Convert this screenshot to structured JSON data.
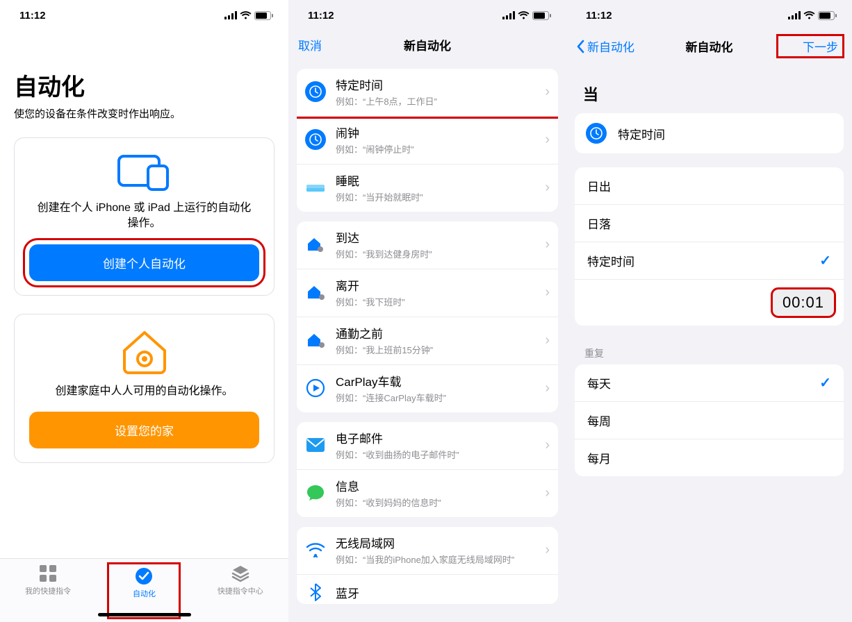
{
  "status": {
    "time": "11:12"
  },
  "screen1": {
    "title": "自动化",
    "subtitle": "使您的设备在条件改变时作出响应。",
    "card_personal": {
      "desc": "创建在个人 iPhone 或 iPad 上运行的自动化操作。",
      "button": "创建个人自动化"
    },
    "card_home": {
      "desc": "创建家庭中人人可用的自动化操作。",
      "button": "设置您的家"
    },
    "tabs": {
      "shortcuts": "我的快捷指令",
      "automation": "自动化",
      "gallery": "快捷指令中心"
    }
  },
  "screen2": {
    "nav_cancel": "取消",
    "nav_title": "新自动化",
    "groups": [
      [
        {
          "title": "特定时间",
          "sub": "例如：“上午8点，工作日”",
          "icon": "clock"
        },
        {
          "title": "闹钟",
          "sub": "例如：“闹钟停止时”",
          "icon": "clock"
        },
        {
          "title": "睡眠",
          "sub": "例如：“当开始就眠时”",
          "icon": "bed"
        }
      ],
      [
        {
          "title": "到达",
          "sub": "例如：“我到达健身房时”",
          "icon": "arrive"
        },
        {
          "title": "离开",
          "sub": "例如：“我下班时”",
          "icon": "leave"
        },
        {
          "title": "通勤之前",
          "sub": "例如：“我上班前15分钟”",
          "icon": "commute"
        },
        {
          "title": "CarPlay车载",
          "sub": "例如：“连接CarPlay车载时”",
          "icon": "carplay"
        }
      ],
      [
        {
          "title": "电子邮件",
          "sub": "例如：“收到曲扬的电子邮件时”",
          "icon": "mail"
        },
        {
          "title": "信息",
          "sub": "例如：“收到妈妈的信息时”",
          "icon": "message"
        }
      ],
      [
        {
          "title": "无线局域网",
          "sub": "例如：“当我的iPhone加入家庭无线局域网时”",
          "icon": "wifi"
        },
        {
          "title": "蓝牙",
          "sub": "",
          "icon": "bluetooth"
        }
      ]
    ]
  },
  "screen3": {
    "nav_back": "新自动化",
    "nav_title": "新自动化",
    "nav_next": "下一步",
    "when_label": "当",
    "trigger_name": "特定时间",
    "time_options": {
      "sunrise": "日出",
      "sunset": "日落",
      "specific": "特定时间"
    },
    "time_value": "00:01",
    "repeat_label": "重复",
    "repeat_options": {
      "daily": "每天",
      "weekly": "每周",
      "monthly": "每月"
    }
  }
}
